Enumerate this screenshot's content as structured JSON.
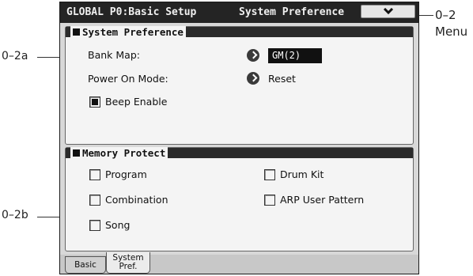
{
  "header": {
    "title_left": "GLOBAL P0:Basic Setup",
    "title_right": "System Preference"
  },
  "callouts": {
    "menu_number": "0–2",
    "menu_word": "Menu",
    "a": "0–2a",
    "b": "0–2b"
  },
  "system_preference": {
    "title": "System Preference",
    "bank_map_label": "Bank Map:",
    "bank_map_value": "GM(2)",
    "power_on_label": "Power On Mode:",
    "power_on_value": "Reset",
    "beep_label": "Beep Enable",
    "beep_checked": true
  },
  "memory_protect": {
    "title": "Memory Protect",
    "program": "Program",
    "combination": "Combination",
    "song": "Song",
    "drum_kit": "Drum Kit",
    "arp": "ARP User Pattern"
  },
  "tabs": {
    "basic": "Basic",
    "system_line1": "System",
    "system_line2": "Pref."
  }
}
